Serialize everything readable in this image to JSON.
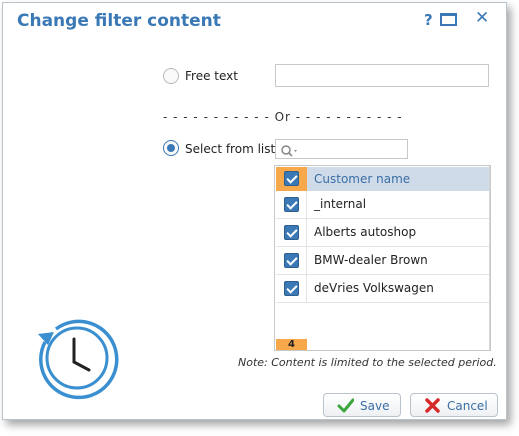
{
  "dialog": {
    "title": "Change filter content",
    "help_label": "?"
  },
  "free_text": {
    "label": "Free text",
    "value": ""
  },
  "divider": "- - - - - - - - - - - Or - - - - - - - - - - -",
  "select_from_list": {
    "label": "Select from list",
    "search_value": ""
  },
  "list": {
    "header": "Customer name",
    "rows": [
      {
        "label": "_internal",
        "checked": true
      },
      {
        "label": "Alberts autoshop",
        "checked": true
      },
      {
        "label": "BMW-dealer Brown",
        "checked": true
      },
      {
        "label": "deVries Volkswagen",
        "checked": true
      }
    ],
    "count": "4"
  },
  "note": "Note: Content is limited to the selected period.",
  "buttons": {
    "save": "Save",
    "cancel": "Cancel"
  },
  "colors": {
    "accent": "#3a79b5",
    "highlight": "#f6a84a",
    "header_bg": "#cfdbe9"
  },
  "icons": {
    "clock": "clock-history-icon",
    "save": "checkmark-icon",
    "cancel": "red-x-icon"
  }
}
